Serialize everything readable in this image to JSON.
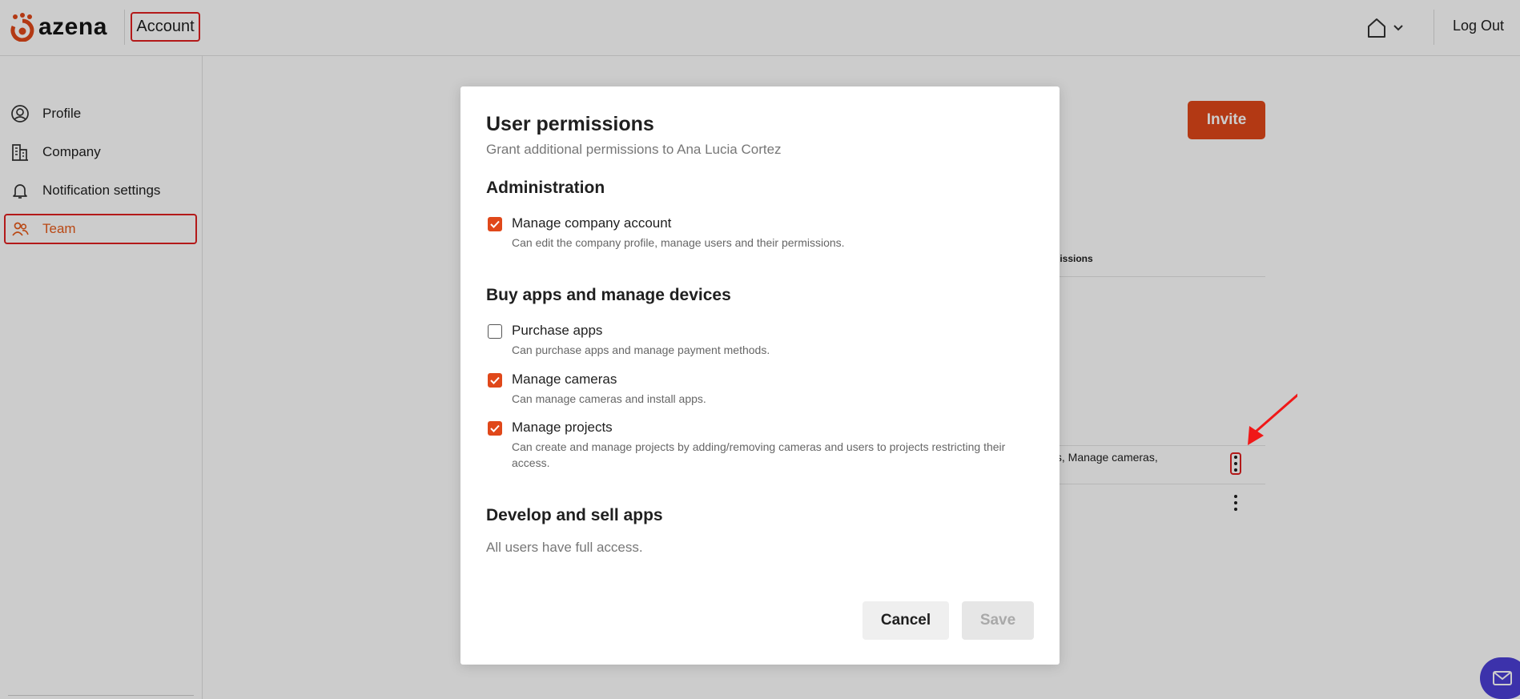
{
  "header": {
    "logo_text": "azena",
    "section_link": "Account",
    "logout_label": "Log Out"
  },
  "sidebar": {
    "items": [
      {
        "label": "Profile",
        "icon": "profile-icon"
      },
      {
        "label": "Company",
        "icon": "building-icon"
      },
      {
        "label": "Notification settings",
        "icon": "bell-icon"
      },
      {
        "label": "Team",
        "icon": "team-icon",
        "active": true
      }
    ]
  },
  "team_page": {
    "invite_label": "Invite",
    "column_header_fragment": "rmissions",
    "row_permissions_fragment": "cts, Manage cameras,"
  },
  "modal": {
    "title": "User permissions",
    "subtitle": "Grant additional permissions to Ana Lucia Cortez",
    "sections": [
      {
        "title": "Administration",
        "permissions": [
          {
            "label": "Manage company account",
            "description": "Can edit the company profile, manage users and their permissions.",
            "checked": true
          }
        ]
      },
      {
        "title": "Buy apps and manage devices",
        "permissions": [
          {
            "label": "Purchase apps",
            "description": "Can purchase apps and manage payment methods.",
            "checked": false
          },
          {
            "label": "Manage cameras",
            "description": "Can manage cameras and install apps.",
            "checked": true
          },
          {
            "label": "Manage projects",
            "description": "Can create and manage projects by adding/removing cameras and users to projects restricting their access.",
            "checked": true
          }
        ]
      },
      {
        "title": "Develop and sell apps",
        "note": "All users have full access."
      }
    ],
    "cancel_label": "Cancel",
    "save_label": "Save"
  },
  "colors": {
    "accent": "#e0481a",
    "highlight": "#e02020",
    "chat": "#4b3fd6"
  }
}
